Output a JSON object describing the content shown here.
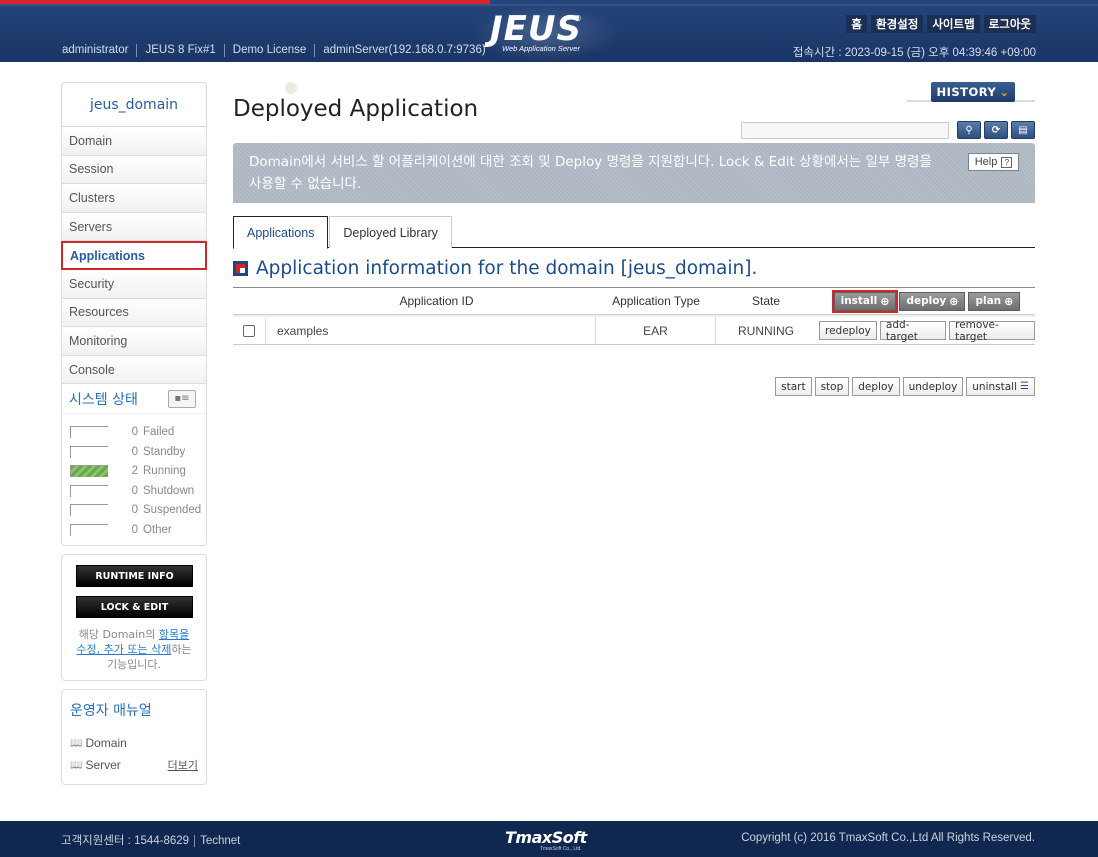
{
  "header": {
    "info": [
      "administrator",
      "JEUS 8 Fix#1",
      "Demo License",
      "adminServer(192.168.0.7:9736)"
    ],
    "logo_text": "JEUS",
    "logo_sub": "Web Application Server",
    "nav": [
      "홈",
      "환경설정",
      "사이트맵",
      "로그아웃"
    ],
    "access_time": "접속시간 : 2023-09-15 (금) 오후 04:39:46 +09:00",
    "colors": {
      "bar": "#24457b",
      "accent_red": "#d9232e"
    }
  },
  "sidebar": {
    "domain": "jeus_domain",
    "menu": [
      {
        "label": "Domain",
        "active": false
      },
      {
        "label": "Session",
        "active": false
      },
      {
        "label": "Clusters",
        "active": false
      },
      {
        "label": "Servers",
        "active": false
      },
      {
        "label": "Applications",
        "active": true
      },
      {
        "label": "Security",
        "active": false
      },
      {
        "label": "Resources",
        "active": false
      },
      {
        "label": "Monitoring",
        "active": false
      },
      {
        "label": "Console",
        "active": false
      }
    ],
    "status": {
      "title": "시스템 상태",
      "items": [
        {
          "count": "0",
          "label": "Failed",
          "fill": 0
        },
        {
          "count": "0",
          "label": "Standby",
          "fill": 0
        },
        {
          "count": "2",
          "label": "Running",
          "fill": 1
        },
        {
          "count": "0",
          "label": "Shutdown",
          "fill": 0
        },
        {
          "count": "0",
          "label": "Suspended",
          "fill": 0
        },
        {
          "count": "0",
          "label": "Other",
          "fill": 0
        }
      ]
    },
    "runtime_info": "RUNTIME INFO",
    "lock_edit": "LOCK & EDIT",
    "lock_note": {
      "before": "해당 Domain의 ",
      "link": "항목을 수정, 추가 또는 삭제",
      "after": "하는 기능입니다."
    },
    "manual": {
      "title": "운영자 매뉴얼",
      "items": [
        "Domain",
        "Server"
      ],
      "more": "더보기"
    }
  },
  "main": {
    "history": "HISTORY",
    "title": "Deployed Application",
    "search": {
      "value": "",
      "placeholder": ""
    },
    "description": "Domain에서 서비스 할 어플리케이션에 대한 조회 및 Deploy 명령을 지원합니다. Lock & Edit 상황에서는 일부 명령을 사용할 수 없습니다.",
    "help": "Help",
    "tabs": [
      {
        "label": "Applications",
        "active": true
      },
      {
        "label": "Deployed Library",
        "active": false
      }
    ],
    "section_title": "Application information for the domain [jeus_domain].",
    "table": {
      "headers": {
        "id": "Application ID",
        "type": "Application Type",
        "state": "State"
      },
      "header_buttons": [
        "install",
        "deploy",
        "plan"
      ],
      "rows": [
        {
          "id": "examples",
          "type": "EAR",
          "state": "RUNNING",
          "actions": [
            "redeploy",
            "add-target",
            "remove-target"
          ]
        }
      ]
    },
    "bottom_buttons": [
      "start",
      "stop",
      "deploy",
      "undeploy",
      "uninstall"
    ]
  },
  "footer": {
    "support": "고객지원센터 : 1544-8629",
    "technet": "Technet",
    "brand": "TmaxSoft",
    "brand_sub": "TmaxSoft Co., Ltd.",
    "copyright": "Copyright (c) 2016 TmaxSoft Co.,Ltd All Rights Reserved."
  }
}
